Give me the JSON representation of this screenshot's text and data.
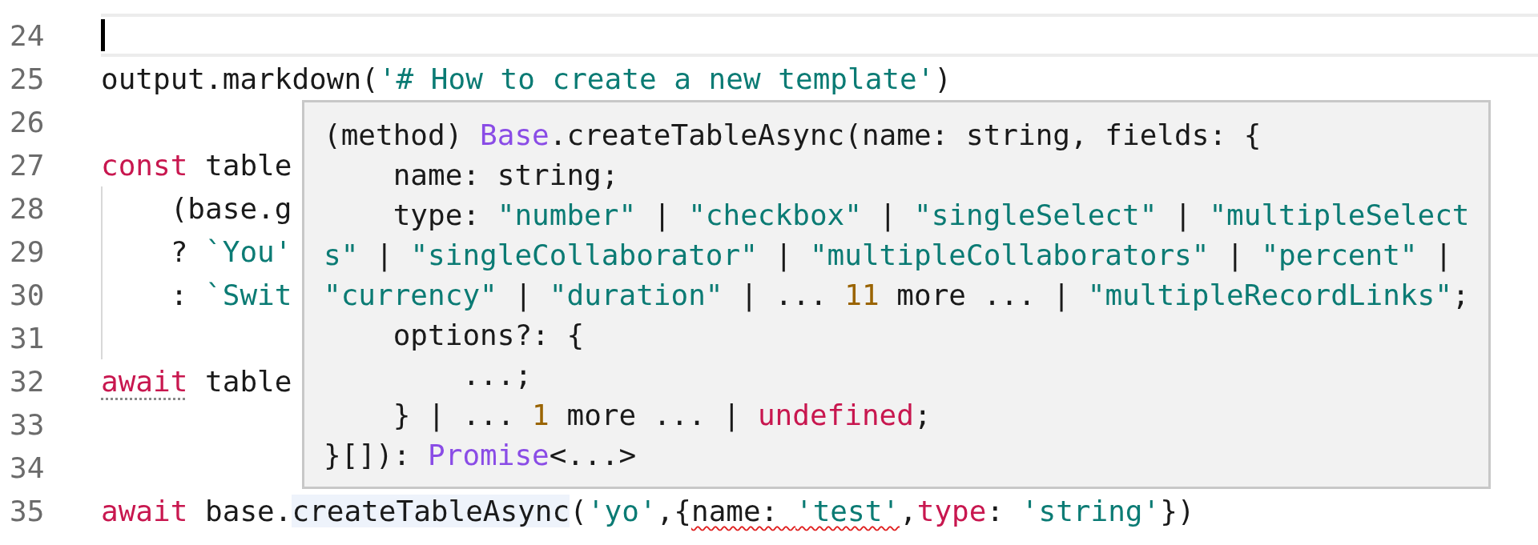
{
  "editor": {
    "lines": [
      {
        "number": "24",
        "current": true,
        "indent_guide": false
      },
      {
        "number": "25",
        "current": false,
        "indent_guide": false,
        "tokens": [
          {
            "text": "output.markdown(",
            "kind": "plain"
          },
          {
            "text": "'# How to create a new template'",
            "kind": "string"
          },
          {
            "text": ")",
            "kind": "plain"
          }
        ]
      },
      {
        "number": "26",
        "current": false,
        "indent_guide": false
      },
      {
        "number": "27",
        "current": false,
        "indent_guide": false,
        "tokens": [
          {
            "text": "const",
            "kind": "keyword"
          },
          {
            "text": " table",
            "kind": "plain"
          }
        ]
      },
      {
        "number": "28",
        "current": false,
        "indent_guide": true,
        "tokens": [
          {
            "text": "    (base.g",
            "kind": "plain"
          }
        ]
      },
      {
        "number": "29",
        "current": false,
        "indent_guide": true,
        "tokens": [
          {
            "text": "    ? ",
            "kind": "plain"
          },
          {
            "text": "`You'",
            "kind": "string"
          }
        ]
      },
      {
        "number": "30",
        "current": false,
        "indent_guide": true,
        "tokens": [
          {
            "text": "    : ",
            "kind": "plain"
          },
          {
            "text": "`Swit",
            "kind": "string"
          }
        ]
      },
      {
        "number": "31",
        "current": false,
        "indent_guide": true
      },
      {
        "number": "32",
        "current": false,
        "indent_guide": false,
        "tokens": [
          {
            "text": "await",
            "kind": "hinted"
          },
          {
            "text": " table",
            "kind": "plain"
          }
        ]
      },
      {
        "number": "33",
        "current": false,
        "indent_guide": false
      },
      {
        "number": "34",
        "current": false,
        "indent_guide": false
      },
      {
        "number": "35",
        "current": false,
        "indent_guide": false,
        "tokens": [
          {
            "text": "await",
            "kind": "keyword"
          },
          {
            "text": " base.",
            "kind": "plain"
          },
          {
            "text": "createTableAsync",
            "kind": "hovered"
          },
          {
            "text": "(",
            "kind": "plain"
          },
          {
            "text": "'yo'",
            "kind": "string"
          },
          {
            "text": ",{",
            "kind": "plain"
          },
          {
            "text": "name: ",
            "kind": "error"
          },
          {
            "text": "'test'",
            "kind": "errstring"
          },
          {
            "text": ",",
            "kind": "plain"
          },
          {
            "text": "type",
            "kind": "keyword"
          },
          {
            "text": ": ",
            "kind": "plain"
          },
          {
            "text": "'string'",
            "kind": "string"
          },
          {
            "text": "})",
            "kind": "plain"
          }
        ]
      }
    ]
  },
  "tooltip": {
    "lines": [
      [
        {
          "text": "(method) ",
          "kind": "plain"
        },
        {
          "text": "Base",
          "kind": "type"
        },
        {
          "text": ".createTableAsync(name: string, fields: {",
          "kind": "plain"
        }
      ],
      [
        {
          "text": "    name: string;",
          "kind": "plain"
        }
      ],
      [
        {
          "text": "    type: ",
          "kind": "plain"
        },
        {
          "text": "\"number\"",
          "kind": "string"
        },
        {
          "text": " | ",
          "kind": "plain"
        },
        {
          "text": "\"checkbox\"",
          "kind": "string"
        },
        {
          "text": " | ",
          "kind": "plain"
        },
        {
          "text": "\"singleSelect\"",
          "kind": "string"
        },
        {
          "text": " | ",
          "kind": "plain"
        },
        {
          "text": "\"multipleSelect",
          "kind": "string"
        }
      ],
      [
        {
          "text": "s\"",
          "kind": "string"
        },
        {
          "text": " | ",
          "kind": "plain"
        },
        {
          "text": "\"singleCollaborator\"",
          "kind": "string"
        },
        {
          "text": " | ",
          "kind": "plain"
        },
        {
          "text": "\"multipleCollaborators\"",
          "kind": "string"
        },
        {
          "text": " | ",
          "kind": "plain"
        },
        {
          "text": "\"percent\"",
          "kind": "string"
        },
        {
          "text": " |",
          "kind": "plain"
        }
      ],
      [
        {
          "text": "\"currency\"",
          "kind": "string"
        },
        {
          "text": " | ",
          "kind": "plain"
        },
        {
          "text": "\"duration\"",
          "kind": "string"
        },
        {
          "text": " | ... ",
          "kind": "plain"
        },
        {
          "text": "11",
          "kind": "number"
        },
        {
          "text": " more ... | ",
          "kind": "plain"
        },
        {
          "text": "\"multipleRecordLinks\"",
          "kind": "string"
        },
        {
          "text": ";",
          "kind": "plain"
        }
      ],
      [
        {
          "text": "    options?: {",
          "kind": "plain"
        }
      ],
      [
        {
          "text": "        ...;",
          "kind": "plain"
        }
      ],
      [
        {
          "text": "    } | ... ",
          "kind": "plain"
        },
        {
          "text": "1",
          "kind": "number"
        },
        {
          "text": " more ... | ",
          "kind": "plain"
        },
        {
          "text": "undefined",
          "kind": "keyword"
        },
        {
          "text": ";",
          "kind": "plain"
        }
      ],
      [
        {
          "text": "}[]): ",
          "kind": "plain"
        },
        {
          "text": "Promise",
          "kind": "type"
        },
        {
          "text": "<...>",
          "kind": "plain"
        }
      ]
    ]
  }
}
